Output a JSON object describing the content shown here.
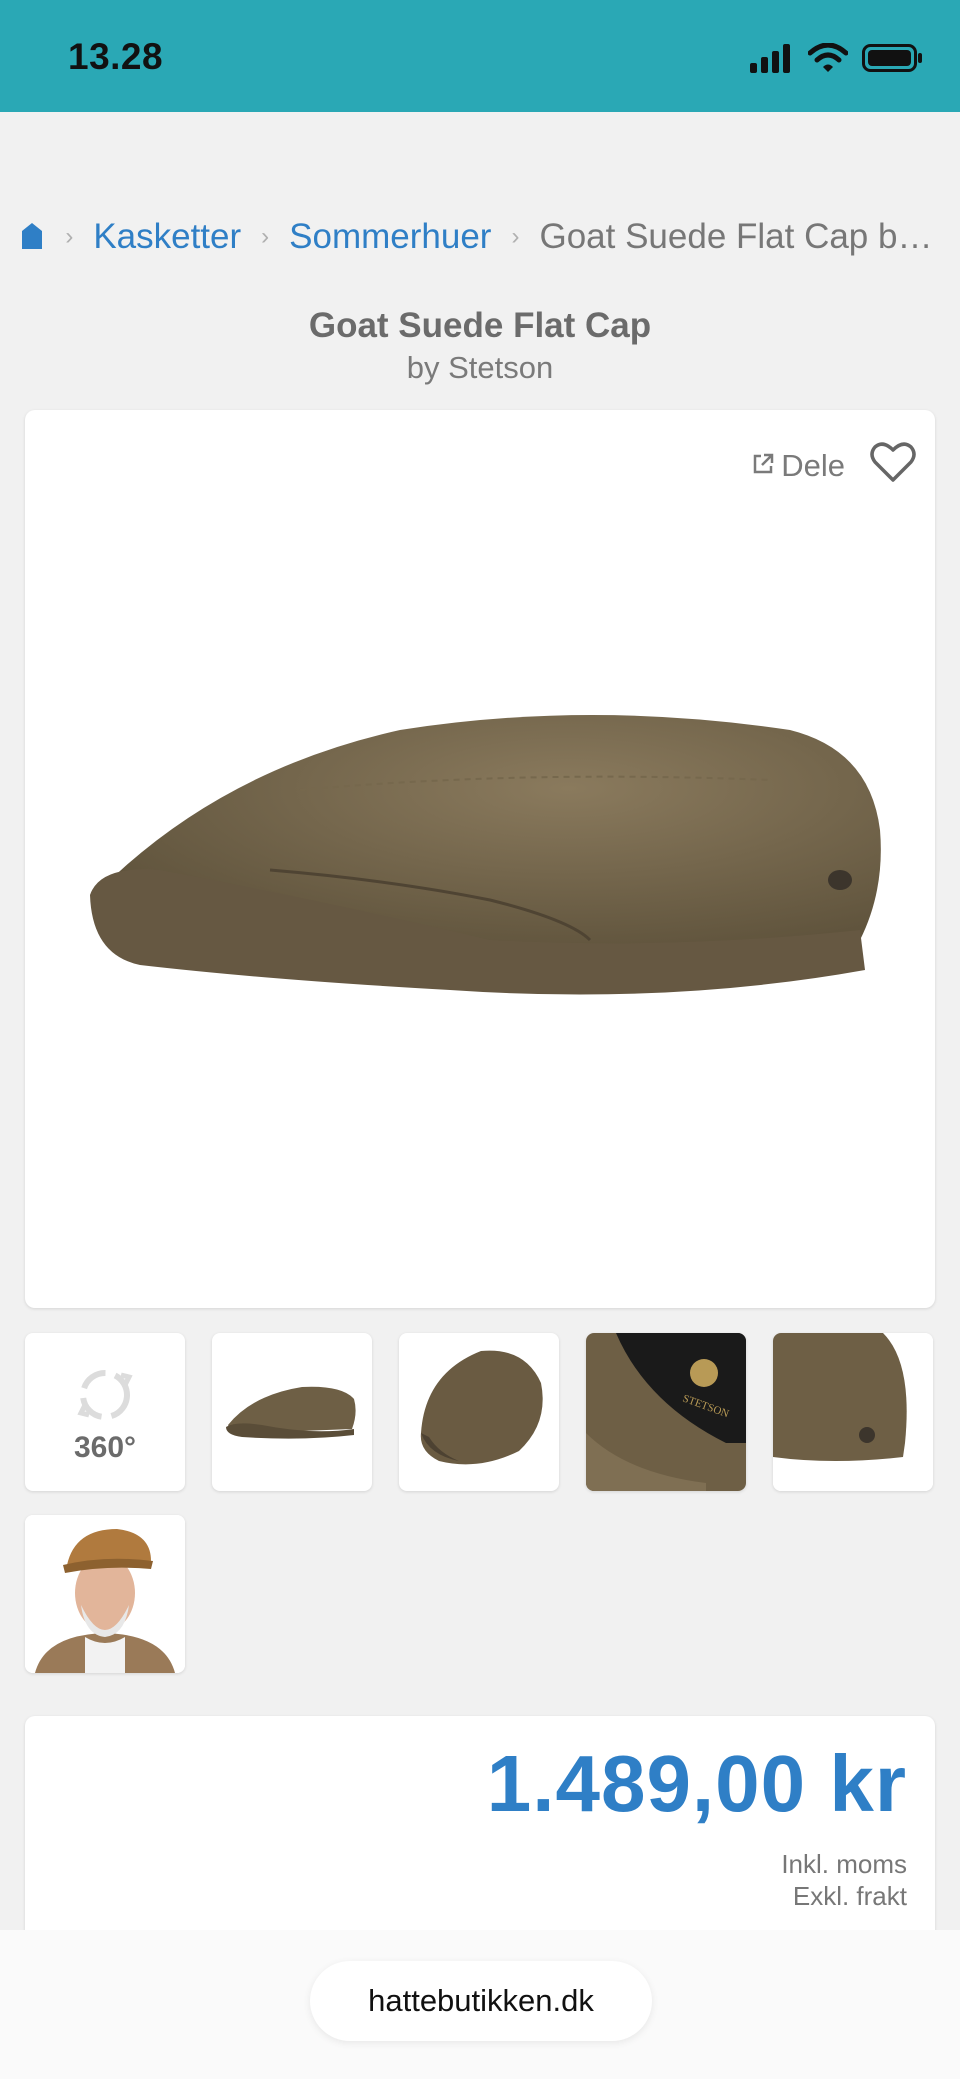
{
  "status_bar": {
    "time": "13.28"
  },
  "breadcrumb": {
    "items": [
      {
        "label": "Kasketter"
      },
      {
        "label": "Sommerhuer"
      }
    ],
    "current": "Goat Suede Flat Cap by ..."
  },
  "product": {
    "title": "Goat Suede Flat Cap",
    "brand": "by Stetson",
    "share_label": "Dele",
    "thumb_360_label": "360°",
    "price": "1.489,00 kr",
    "tax_line_1": "Inkl. moms",
    "tax_line_2": "Exkl. frakt"
  },
  "browser": {
    "url": "hattebutikken.dk"
  },
  "colors": {
    "status_bar": "#2aa8b5",
    "link_blue": "#2f7fc6",
    "cap_brown": "#6e5f45"
  },
  "icons": [
    "signal-icon",
    "wifi-icon",
    "battery-icon",
    "home-icon",
    "share-icon",
    "heart-icon",
    "rotate-360-icon"
  ]
}
